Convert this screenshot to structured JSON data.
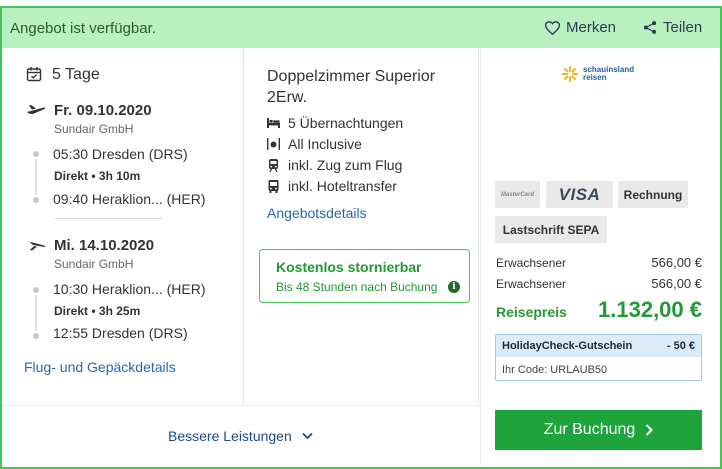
{
  "header": {
    "availability": "Angebot ist verfügbar.",
    "save_label": "Merken",
    "share_label": "Teilen"
  },
  "flights": {
    "duration": "5 Tage",
    "outbound": {
      "date": "Fr. 09.10.2020",
      "carrier": "Sundair GmbH",
      "departure": "05:30 Dresden (DRS)",
      "direct": "Direkt",
      "flight_time": "3h 10m",
      "arrival": "09:40 Heraklion... (HER)"
    },
    "return": {
      "date": "Mi. 14.10.2020",
      "carrier": "Sundair GmbH",
      "departure": "10:30 Heraklion... (HER)",
      "direct": "Direkt",
      "flight_time": "3h 25m",
      "arrival": "12:55 Dresden (DRS)"
    },
    "details_link": "Flug- und Gepäckdetails"
  },
  "offer": {
    "room": "Doppelzimmer Superior 2Erw.",
    "features": [
      {
        "icon": "bed-icon",
        "label": "5 Übernachtungen"
      },
      {
        "icon": "cutlery-icon",
        "label": "All Inclusive"
      },
      {
        "icon": "train-icon",
        "label": "inkl. Zug zum Flug"
      },
      {
        "icon": "bus-icon",
        "label": "inkl. Hoteltransfer"
      }
    ],
    "details_link": "Angebotsdetails",
    "cancellation": {
      "title": "Kostenlos stornierbar",
      "subtitle": "Bis 48 Stunden nach Buchung",
      "info_glyph": "i"
    },
    "more_link": "Bessere Leistungen"
  },
  "price": {
    "operator_line1": "schauinsland",
    "operator_line2": "reisen",
    "payment": {
      "mastercard": "MasterCard",
      "visa": "VISA",
      "invoice": "Rechnung",
      "sepa": "Lastschrift SEPA"
    },
    "travellers": [
      {
        "label": "Erwachsener",
        "amount": "566,00 €"
      },
      {
        "label": "Erwachsener",
        "amount": "566,00 €"
      }
    ],
    "total_label": "Reisepreis",
    "total": "1.132,00 €",
    "voucher": {
      "title": "HolidayCheck-Gutschein",
      "amount": "- 50 €",
      "code": "Ihr Code: URLAUB50"
    },
    "book_label": "Zur Buchung"
  },
  "colors": {
    "accent_green": "#1ea43a",
    "banner_green": "#b8f0c0",
    "border_green": "#44c656",
    "link_blue": "#2a66b5"
  }
}
